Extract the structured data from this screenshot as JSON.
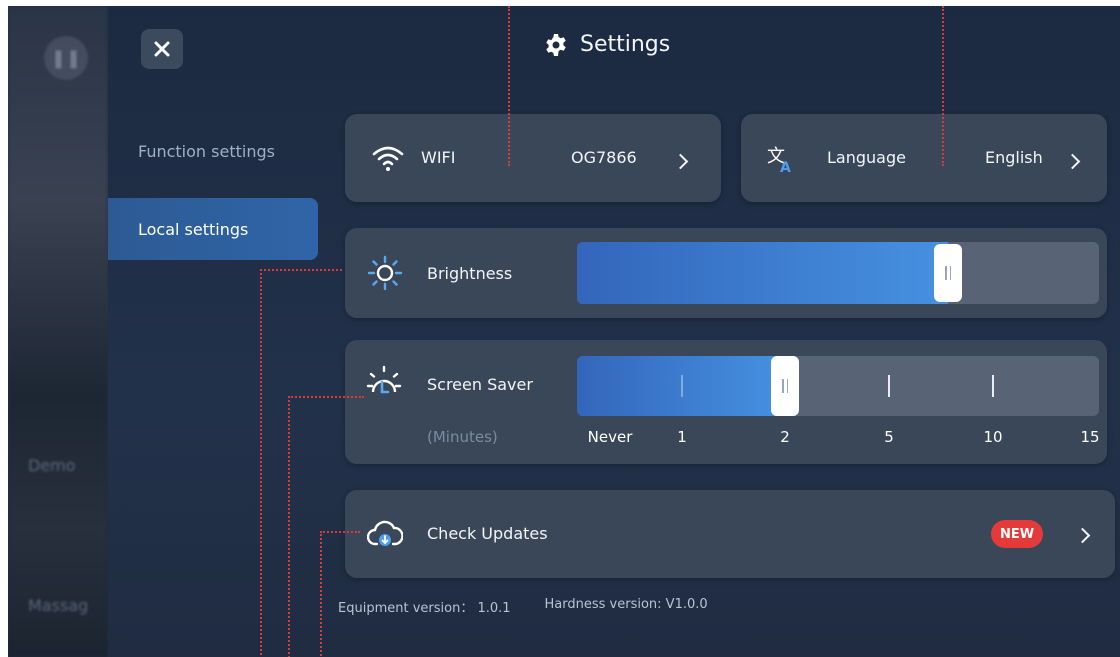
{
  "background": {
    "demo_label": "Demo",
    "massage_label": "Massag"
  },
  "header": {
    "title": "Settings",
    "icon": "gear-icon"
  },
  "close": {
    "icon": "close-icon"
  },
  "sidebar": {
    "items": [
      {
        "label": "Function settings",
        "active": false
      },
      {
        "label": "Local settings",
        "active": true
      }
    ]
  },
  "wifi": {
    "label": "WIFI",
    "value": "OG7866",
    "icon": "wifi-icon"
  },
  "language": {
    "label": "Language",
    "value": "English",
    "icon": "translate-icon"
  },
  "brightness": {
    "label": "Brightness",
    "level": 0.71,
    "icon": "sun-icon"
  },
  "screen_saver": {
    "label": "Screen Saver",
    "unit": "(Minutes)",
    "options": [
      "Never",
      "1",
      "2",
      "5",
      "10",
      "15"
    ],
    "selected": "2",
    "icon": "screen-saver-icon"
  },
  "updates": {
    "label": "Check Updates",
    "badge": "NEW",
    "icon": "cloud-download-icon"
  },
  "footer": {
    "equipment_version": "Equipment version： 1.0.1",
    "hardness_version": "Hardness version: V1.0.0"
  },
  "colors": {
    "accent": "#3f86d8",
    "badge": "#e43a3a",
    "annotation": "#d43b3b"
  }
}
